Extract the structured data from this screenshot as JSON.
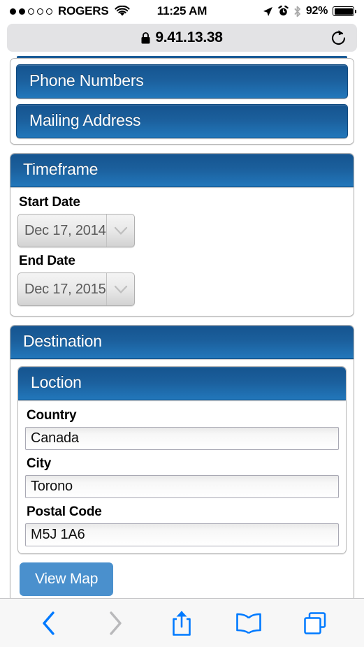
{
  "status_bar": {
    "signal_filled": 2,
    "signal_total": 5,
    "carrier": "ROGERS",
    "wifi_icon": "wifi-icon",
    "time": "11:25 AM",
    "location_icon": "location-arrow-icon",
    "alarm_icon": "alarm-clock-icon",
    "bluetooth_icon": "bluetooth-icon",
    "battery_percent": "92%",
    "battery_icon": "battery-full-icon"
  },
  "browser": {
    "lock_icon": "lock-icon",
    "url": "9.41.13.38",
    "reload_icon": "reload-icon"
  },
  "page": {
    "top_section": {
      "buttons": [
        {
          "label": "Phone Numbers"
        },
        {
          "label": "Mailing Address"
        }
      ]
    },
    "timeframe": {
      "header": "Timeframe",
      "fields": [
        {
          "label": "Start Date",
          "value": "Dec 17, 2014",
          "arrow_icon": "chevron-down-icon"
        },
        {
          "label": "End Date",
          "value": "Dec 17, 2015",
          "arrow_icon": "chevron-down-icon"
        }
      ]
    },
    "destination": {
      "header": "Destination",
      "location": {
        "header": "Loction",
        "fields": [
          {
            "label": "Country",
            "value": "Canada"
          },
          {
            "label": "City",
            "value": "Torono"
          },
          {
            "label": "Postal Code",
            "value": "M5J 1A6"
          }
        ],
        "view_map_label": "View Map"
      }
    }
  },
  "toolbar": {
    "back_icon": "back-chevron-icon",
    "forward_icon": "forward-chevron-icon",
    "share_icon": "share-icon",
    "bookmarks_icon": "bookmarks-book-icon",
    "tabs_icon": "tabs-icon"
  },
  "colors": {
    "header_blue_top": "#15548f",
    "header_blue_bottom": "#2277bb",
    "button_blue": "#4a90cd",
    "ios_blue": "#007aff",
    "disabled_gray": "#b9b9bb"
  }
}
